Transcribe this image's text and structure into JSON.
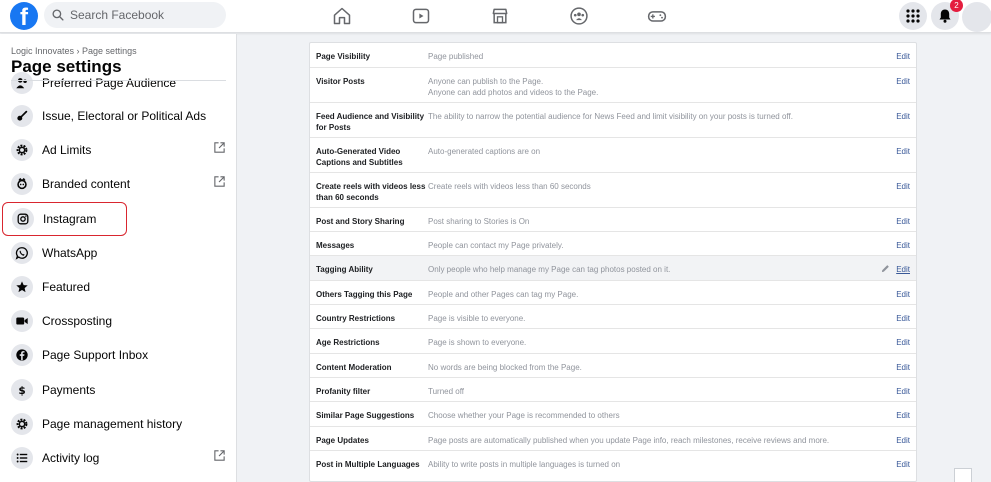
{
  "topbar": {
    "logo_letter": "f",
    "search_placeholder": "Search Facebook",
    "nav_icons": [
      "home-icon",
      "watch-icon",
      "marketplace-icon",
      "groups-icon",
      "gaming-icon"
    ],
    "right_icons": [
      "menu-grid-icon",
      "notifications-bell-icon"
    ],
    "notification_count": "2"
  },
  "sidebar": {
    "breadcrumb": "Logic Innovates › Page settings",
    "title": "Page settings",
    "items": [
      {
        "label": "Preferred Page Audience",
        "icon": "audience-icon",
        "external": false
      },
      {
        "label": "Issue, Electoral or Political Ads",
        "icon": "political-ads-icon",
        "external": false
      },
      {
        "label": "Ad Limits",
        "icon": "gear-icon",
        "external": true
      },
      {
        "label": "Branded content",
        "icon": "branded-content-icon",
        "external": true
      },
      {
        "label": "Instagram",
        "icon": "instagram-icon",
        "external": false
      },
      {
        "label": "WhatsApp",
        "icon": "whatsapp-icon",
        "external": false
      },
      {
        "label": "Featured",
        "icon": "star-icon",
        "external": false
      },
      {
        "label": "Crossposting",
        "icon": "video-camera-icon",
        "external": false
      },
      {
        "label": "Page Support Inbox",
        "icon": "facebook-icon",
        "external": false
      },
      {
        "label": "Payments",
        "icon": "dollar-icon",
        "external": false
      },
      {
        "label": "Page management history",
        "icon": "gear-icon",
        "external": false
      },
      {
        "label": "Activity log",
        "icon": "list-icon",
        "external": true
      }
    ]
  },
  "settings": {
    "edit_label": "Edit",
    "rows": [
      {
        "label": "Page Visibility",
        "value": "Page published"
      },
      {
        "label": "Visitor Posts",
        "value": "Anyone can publish to the Page.",
        "value2": "Anyone can add photos and videos to the Page."
      },
      {
        "label": "Feed Audience and Visibility for Posts",
        "value": "The ability to narrow the potential audience for News Feed and limit visibility on your posts is turned off."
      },
      {
        "label": "Auto-Generated Video Captions and Subtitles",
        "value": "Auto-generated captions are on"
      },
      {
        "label": "Create reels with videos less than 60 seconds",
        "value": "Create reels with videos less than 60 seconds"
      },
      {
        "label": "Post and Story Sharing",
        "value": "Post sharing to Stories is On"
      },
      {
        "label": "Messages",
        "value": "People can contact my Page privately."
      },
      {
        "label": "Tagging Ability",
        "value": "Only people who help manage my Page can tag photos posted on it."
      },
      {
        "label": "Others Tagging this Page",
        "value": "People and other Pages can tag my Page."
      },
      {
        "label": "Country Restrictions",
        "value": "Page is visible to everyone."
      },
      {
        "label": "Age Restrictions",
        "value": "Page is shown to everyone."
      },
      {
        "label": "Content Moderation",
        "value": "No words are being blocked from the Page."
      },
      {
        "label": "Profanity filter",
        "value": "Turned off"
      },
      {
        "label": "Similar Page Suggestions",
        "value": "Choose whether your Page is recommended to others"
      },
      {
        "label": "Page Updates",
        "value": "Page posts are automatically published when you update Page info, reach milestones, receive reviews and more."
      },
      {
        "label": "Post in Multiple Languages",
        "value": "Ability to write posts in multiple languages is turned on"
      }
    ]
  }
}
